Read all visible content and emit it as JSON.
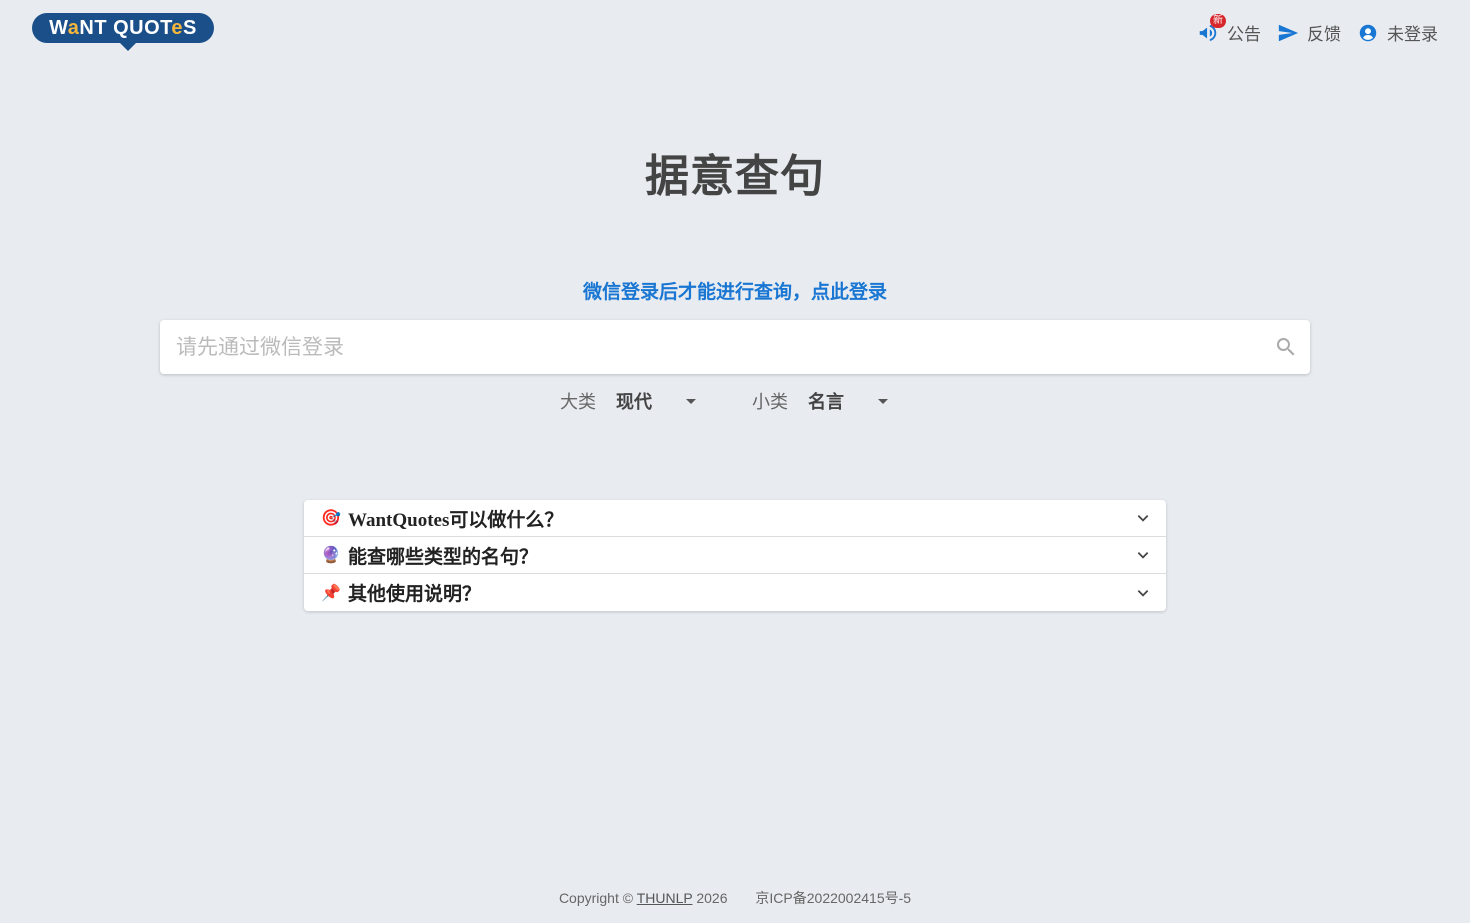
{
  "logo": {
    "text_prefix": "W",
    "text_a": "a",
    "text_mid": "NT QUOT",
    "text_e": "e",
    "text_suffix": "S"
  },
  "nav": {
    "announce_label": "公告",
    "announce_badge": "新",
    "feedback_label": "反馈",
    "user_label": "未登录"
  },
  "main": {
    "title": "据意查句",
    "login_prompt": "微信登录后才能进行查询，点此登录",
    "search_placeholder": "请先通过微信登录",
    "search_value": ""
  },
  "filters": {
    "category_label": "大类",
    "category_value": "现代",
    "subcategory_label": "小类",
    "subcategory_value": "名言"
  },
  "faq": [
    {
      "emoji": "🎯",
      "title": "WantQuotes可以做什么？"
    },
    {
      "emoji": "🔮",
      "title": "能查哪些类型的名句？"
    },
    {
      "emoji": "📌",
      "title": "其他使用说明？"
    }
  ],
  "footer": {
    "copyright_prefix": "Copyright ©",
    "org": "THUNLP",
    "year": "2026",
    "icp": "京ICP备2022002415号-5"
  },
  "colors": {
    "accent": "#1976d2",
    "logo_bg": "#1b4f8a",
    "logo_yellow": "#f5b73b",
    "badge": "#d7262c",
    "bg": "#e8ecf1"
  }
}
